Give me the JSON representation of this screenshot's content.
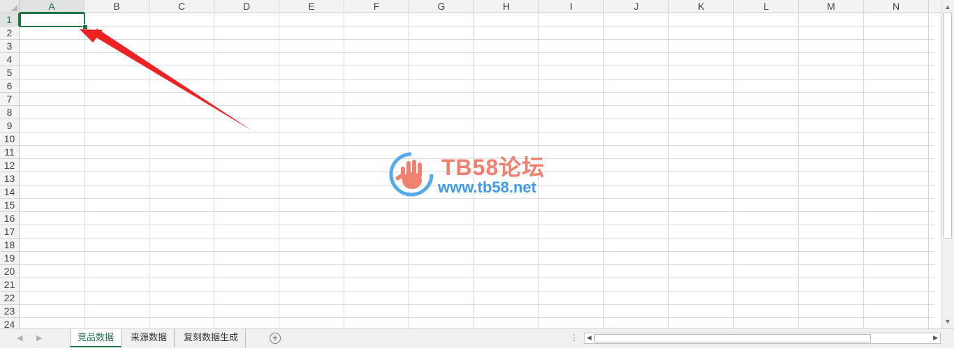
{
  "columns": [
    "A",
    "B",
    "C",
    "D",
    "E",
    "F",
    "G",
    "H",
    "I",
    "J",
    "K",
    "L",
    "M",
    "N"
  ],
  "rows": [
    "1",
    "2",
    "3",
    "4",
    "5",
    "6",
    "7",
    "8",
    "9",
    "10",
    "11",
    "12",
    "13",
    "14",
    "15",
    "16",
    "17",
    "18",
    "19",
    "20",
    "21",
    "22",
    "23",
    "24"
  ],
  "selected_cell": {
    "column": "A",
    "row": "1"
  },
  "sheet_tabs": [
    {
      "label": "竞品数据",
      "active": true
    },
    {
      "label": "来源数据",
      "active": false
    },
    {
      "label": "复刻数据生成",
      "active": false
    }
  ],
  "add_sheet_icon": "plus-circle-icon",
  "watermark": {
    "title": "TB58论坛",
    "url": "www.tb58.net"
  },
  "colors": {
    "accent": "#217346",
    "arrow": "#ee2222",
    "watermark_title": "#f08070",
    "watermark_url": "#3d9be9"
  }
}
